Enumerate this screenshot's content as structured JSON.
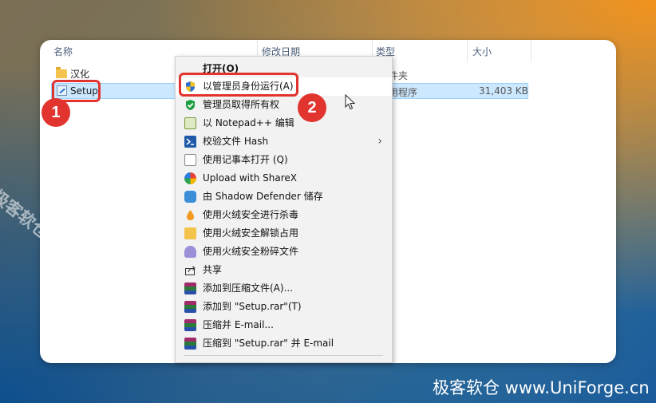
{
  "columns": {
    "name": "名称",
    "modified": "修改日期",
    "type": "类型",
    "size": "大小"
  },
  "files": [
    {
      "name": "汉化",
      "type": "文件夹",
      "size": ""
    },
    {
      "name": "Setup",
      "type": "应用程序",
      "size": "31,403 KB"
    }
  ],
  "badges": {
    "step1": "1",
    "step2": "2"
  },
  "context_menu": {
    "items": [
      {
        "label": "打开(O)",
        "icon": "none"
      },
      {
        "label": "以管理员身份运行(A)",
        "icon": "uac-shield-icon"
      },
      {
        "label": "管理员取得所有权",
        "icon": "green-check-shield-icon"
      },
      {
        "label": "以 Notepad++ 编辑",
        "icon": "notepadpp-icon"
      },
      {
        "label": "校验文件 Hash",
        "icon": "powershell-icon"
      },
      {
        "label": "使用记事本打开 (Q)",
        "icon": "notepad-icon"
      },
      {
        "label": "Upload with ShareX",
        "icon": "sharex-icon"
      },
      {
        "label": "由 Shadow Defender 储存",
        "icon": "shadow-defender-icon"
      },
      {
        "label": "使用火绒安全进行杀毒",
        "icon": "huorong-scan-icon"
      },
      {
        "label": "使用火绒安全解锁占用",
        "icon": "huorong-unlock-icon"
      },
      {
        "label": "使用火绒安全粉碎文件",
        "icon": "huorong-shred-icon"
      },
      {
        "label": "共享",
        "icon": "share-icon"
      },
      {
        "label": "添加到压缩文件(A)...",
        "icon": "winrar-icon"
      },
      {
        "label": "添加到 \"Setup.rar\"(T)",
        "icon": "winrar-icon"
      },
      {
        "label": "压缩并 E-mail...",
        "icon": "winrar-icon"
      },
      {
        "label": "压缩到 \"Setup.rar\" 并 E-mail",
        "icon": "winrar-icon"
      }
    ]
  },
  "watermarks": {
    "diagonal": "极客软仓 UniForge.cn",
    "bottom": "极客软仓 www.UniForge.cn"
  },
  "colors": {
    "highlight_red": "#e2342f",
    "selection": "#cce8ff",
    "menu_bg": "#f2f2f2"
  }
}
